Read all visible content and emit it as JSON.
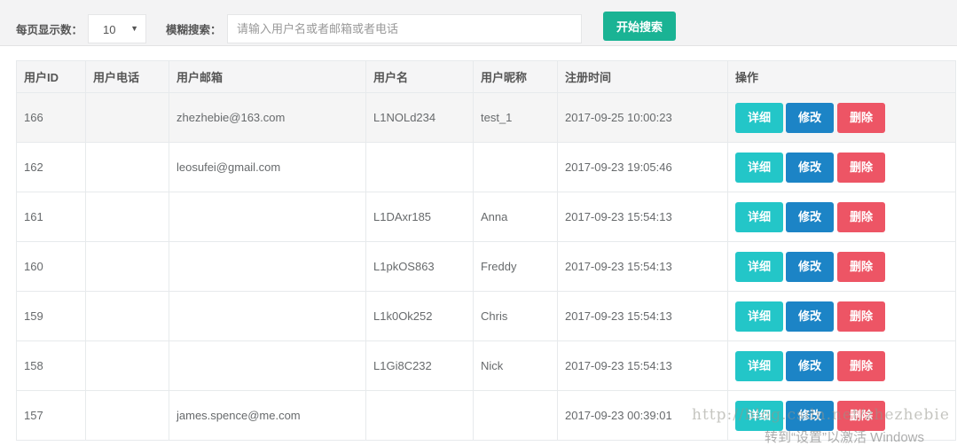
{
  "toolbar": {
    "page_size_label": "每页显示数：",
    "page_size_value": "10",
    "search_label": "模糊搜索：",
    "search_placeholder": "请输入用户名或者邮箱或者电话",
    "search_value": "",
    "search_button": "开始搜索"
  },
  "table": {
    "headers": [
      "用户ID",
      "用户电话",
      "用户邮箱",
      "用户名",
      "用户昵称",
      "注册时间",
      "操作"
    ],
    "actions": {
      "detail": "详细",
      "edit": "修改",
      "delete": "删除"
    },
    "rows": [
      {
        "id": "166",
        "phone": "",
        "email": "zhezhebie@163.com",
        "username": "L1NOLd234",
        "nickname": "test_1",
        "time": "2017-09-25 10:00:23"
      },
      {
        "id": "162",
        "phone": "",
        "email": "leosufei@gmail.com",
        "username": "",
        "nickname": "",
        "time": "2017-09-23 19:05:46"
      },
      {
        "id": "161",
        "phone": "",
        "email": "",
        "username": "L1DAxr185",
        "nickname": "Anna",
        "time": "2017-09-23 15:54:13"
      },
      {
        "id": "160",
        "phone": "",
        "email": "",
        "username": "L1pkOS863",
        "nickname": "Freddy",
        "time": "2017-09-23 15:54:13"
      },
      {
        "id": "159",
        "phone": "",
        "email": "",
        "username": "L1k0Ok252",
        "nickname": "Chris",
        "time": "2017-09-23 15:54:13"
      },
      {
        "id": "158",
        "phone": "",
        "email": "",
        "username": "L1Gi8C232",
        "nickname": "Nick",
        "time": "2017-09-23 15:54:13"
      },
      {
        "id": "157",
        "phone": "",
        "email": "james.spence@me.com",
        "username": "",
        "nickname": "",
        "time": "2017-09-23 00:39:01"
      }
    ]
  },
  "watermark": {
    "url": "http://blog.csdn.net/zhezhebie",
    "windows": "转到“设置”以激活 Windows"
  }
}
